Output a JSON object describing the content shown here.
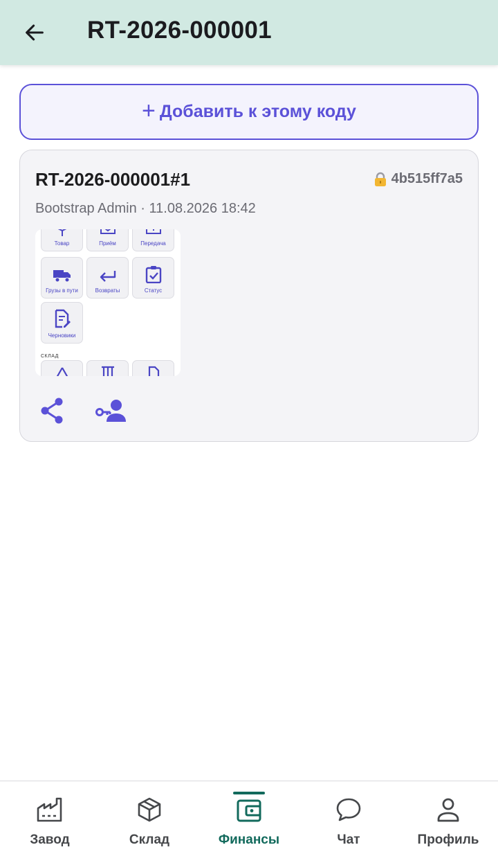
{
  "appbar": {
    "title": "RT-2026-000001"
  },
  "add_button": {
    "plus": "+",
    "label": "Добавить к этому коду"
  },
  "card": {
    "title": "RT-2026-000001#1",
    "hash": "4b515ff7a5",
    "meta": "Bootstrap Admin · 11.08.2026 18:42",
    "thumbnail": {
      "tiles": [
        {
          "label": "Товар",
          "icon": "box-icon"
        },
        {
          "label": "Приём",
          "icon": "inbox-download-icon"
        },
        {
          "label": "Передача",
          "icon": "outbox-upload-icon"
        },
        {
          "label": "Грузы в пути",
          "icon": "truck-icon"
        },
        {
          "label": "Возвраты",
          "icon": "return-arrow-icon"
        },
        {
          "label": "Статус",
          "icon": "clipboard-check-icon"
        },
        {
          "label": "Черновики",
          "icon": "draft-edit-icon"
        }
      ],
      "section_label": "СКЛАД"
    }
  },
  "bottom_nav": {
    "items": [
      {
        "label": "Завод",
        "icon": "factory-icon"
      },
      {
        "label": "Склад",
        "icon": "box-icon"
      },
      {
        "label": "Финансы",
        "icon": "wallet-icon",
        "active": true
      },
      {
        "label": "Чат",
        "icon": "chat-bubble-icon"
      },
      {
        "label": "Профиль",
        "icon": "person-icon"
      }
    ]
  },
  "colors": {
    "accent": "#5b51d8",
    "nav_active": "#126a5c",
    "appbar_bg": "#d1e9e2"
  }
}
